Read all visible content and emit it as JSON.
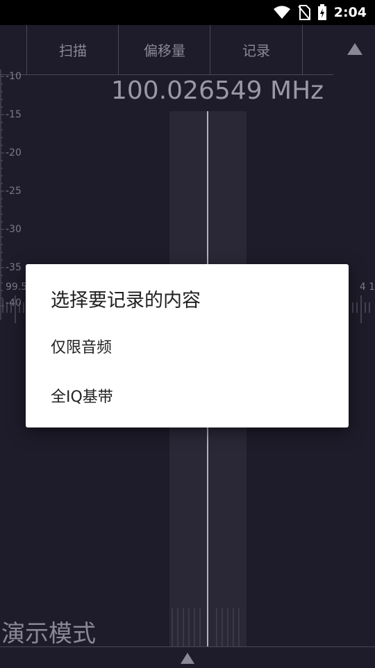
{
  "status_bar": {
    "time": "2:04"
  },
  "tabs": [
    {
      "label": "扫描"
    },
    {
      "label": "偏移量"
    },
    {
      "label": "记录"
    }
  ],
  "frequency": "100.026549 MHz",
  "scale_labels": [
    "-10",
    "-15",
    "-20",
    "-25",
    "-30",
    "-35",
    "-40"
  ],
  "axis_left_label": "99.5",
  "axis_right_label": "4   1",
  "demo_mode": "演示模式",
  "dialog": {
    "title": "选择要记录的内容",
    "options": [
      {
        "label": "仅限音频"
      },
      {
        "label": "全IQ基带"
      }
    ]
  }
}
